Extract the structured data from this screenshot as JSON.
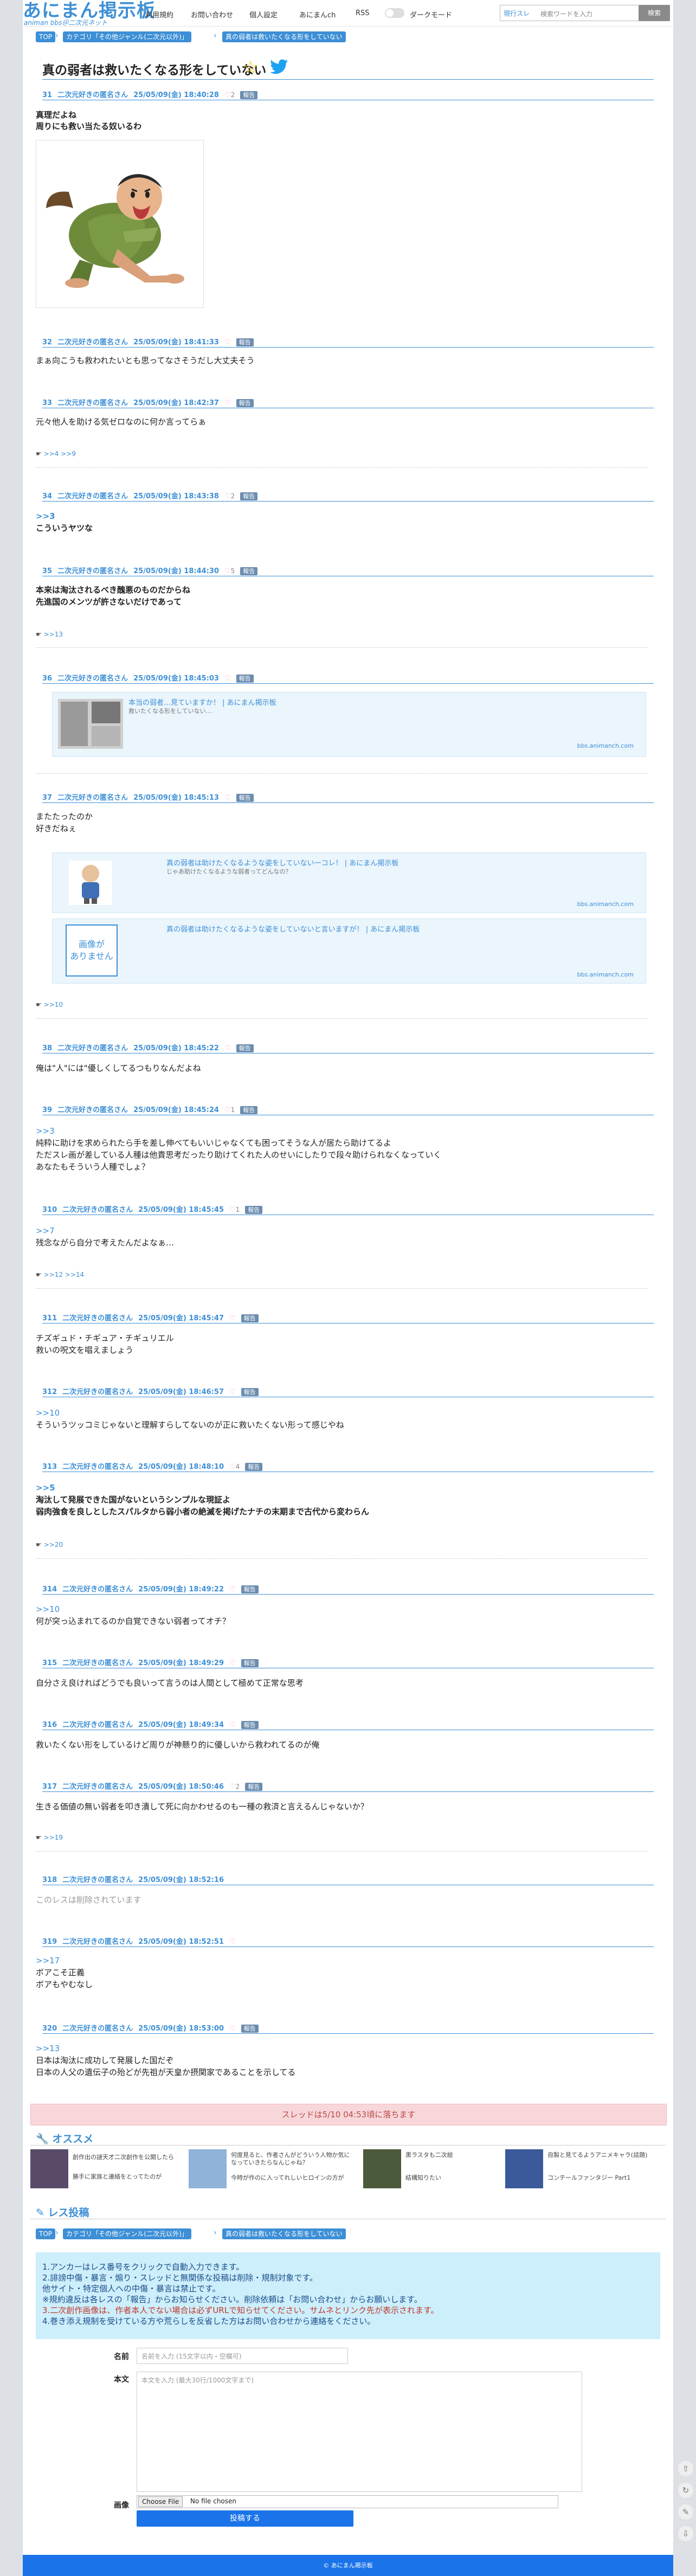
{
  "header": {
    "logo": "あにまん掲示板",
    "logo_sub": "animan bbs＠二次元ネット",
    "nav": [
      "利用規約",
      "お問い合わせ",
      "個人設定",
      "あにまんch",
      "RSS",
      "ダークモード"
    ],
    "search_scope": "現行スレ",
    "search_placeholder": "検索ワードを入力",
    "search_button": "検索"
  },
  "breadcrumb": [
    "TOP",
    "カテゴリ「その他ジャンル(二次元以外)」",
    "真の弱者は救いたくなる形をしていない"
  ],
  "thread_title": "真の弱者は救いたくなる形をしていない",
  "posts": [
    {
      "num": "31",
      "name": "二次元好きの匿名さん",
      "date": "25/05/09(金) 18:40:28",
      "likes": "2",
      "lines": [
        "真理だよね",
        "周りにも救い当たる奴いるわ"
      ],
      "bold": true,
      "replies": ""
    },
    {
      "num": "32",
      "name": "二次元好きの匿名さん",
      "date": "25/05/09(金) 18:41:33",
      "likes": "",
      "lines": [
        "まぁ向こうも救われたいとも思ってなさそうだし大丈夫そう"
      ],
      "bold": false,
      "replies": ""
    },
    {
      "num": "33",
      "name": "二次元好きの匿名さん",
      "date": "25/05/09(金) 18:42:37",
      "likes": "",
      "lines": [
        "元々他人を助ける気ゼロなのに何か言ってらぁ"
      ],
      "bold": false,
      "replies": ">>4 >>9"
    },
    {
      "num": "34",
      "name": "二次元好きの匿名さん",
      "date": "25/05/09(金) 18:43:38",
      "likes": "2",
      "lines": [
        ">>3",
        "こういうヤツな"
      ],
      "bold": true,
      "replies": ""
    },
    {
      "num": "35",
      "name": "二次元好きの匿名さん",
      "date": "25/05/09(金) 18:44:30",
      "likes": "5",
      "lines": [
        "本来は淘汰されるべき醜悪のものだからね",
        "先進国のメンツが許さないだけであって"
      ],
      "bold": true,
      "replies": ">>13"
    },
    {
      "num": "36",
      "name": "二次元好きの匿名さん",
      "date": "25/05/09(金) 18:45:03",
      "likes": "",
      "lines": [],
      "bold": false,
      "replies": ""
    },
    {
      "num": "37",
      "name": "二次元好きの匿名さん",
      "date": "25/05/09(金) 18:45:13",
      "likes": "",
      "lines": [
        "またたったのか",
        "好きだねぇ"
      ],
      "bold": false,
      "replies": ">>10"
    },
    {
      "num": "38",
      "name": "二次元好きの匿名さん",
      "date": "25/05/09(金) 18:45:22",
      "likes": "",
      "lines": [
        "俺は\"人\"には\"優しくしてるつもりなんだよね"
      ],
      "bold": false,
      "replies": ""
    },
    {
      "num": "39",
      "name": "二次元好きの匿名さん",
      "date": "25/05/09(金) 18:45:24",
      "likes": "1",
      "lines": [
        ">>3",
        "純粋に助けを求められたら手を差し伸べてもいいじゃなくても困ってそうな人が居たら助けてるよ",
        "ただスレ画が差している人種は他責思考だったり助けてくれた人のせいにしたりで段々助けられなくなっていく",
        "あなたもそういう人種でしょ？"
      ],
      "bold": false,
      "replies": ""
    },
    {
      "num": "310",
      "name": "二次元好きの匿名さん",
      "date": "25/05/09(金) 18:45:45",
      "likes": "1",
      "lines": [
        ">>7",
        "残念ながら自分で考えたんだよなぁ…"
      ],
      "bold": false,
      "replies": ">>12 >>14"
    },
    {
      "num": "311",
      "name": "二次元好きの匿名さん",
      "date": "25/05/09(金) 18:45:47",
      "likes": "",
      "lines": [
        "チズギュド・チギュア・チギュリエル",
        "救いの呪文を唱えましょう"
      ],
      "bold": false,
      "replies": ""
    },
    {
      "num": "312",
      "name": "二次元好きの匿名さん",
      "date": "25/05/09(金) 18:46:57",
      "likes": "",
      "lines": [
        ">>10",
        "そういうツッコミじゃないと理解すらしてないのが正に救いたくない形って感じやね"
      ],
      "bold": false,
      "replies": ""
    },
    {
      "num": "313",
      "name": "二次元好きの匿名さん",
      "date": "25/05/09(金) 18:48:10",
      "likes": "4",
      "lines": [
        ">>5",
        "淘汰して発展できた国がないというシンプルな現証よ",
        "弱肉強食を良しとしたスパルタから弱小者の絶滅を掲げたナチの末期まで古代から変わらん"
      ],
      "bold": true,
      "replies": ">>20"
    },
    {
      "num": "314",
      "name": "二次元好きの匿名さん",
      "date": "25/05/09(金) 18:49:22",
      "likes": "",
      "lines": [
        ">>10",
        "何が突っ込まれてるのか自覚できない弱者ってオチ？"
      ],
      "bold": false,
      "replies": ""
    },
    {
      "num": "315",
      "name": "二次元好きの匿名さん",
      "date": "25/05/09(金) 18:49:29",
      "likes": "",
      "lines": [
        "自分さえ良ければどうでも良いって言うのは人間として極めて正常な思考"
      ],
      "bold": false,
      "replies": ""
    },
    {
      "num": "316",
      "name": "二次元好きの匿名さん",
      "date": "25/05/09(金) 18:49:34",
      "likes": "",
      "lines": [
        "救いたくない形をしているけど周りが神懸り的に優しいから救われてるのが俺"
      ],
      "bold": false,
      "replies": ""
    },
    {
      "num": "317",
      "name": "二次元好きの匿名さん",
      "date": "25/05/09(金) 18:50:46",
      "likes": "2",
      "lines": [
        "生きる価値の無い弱者を叩き潰して死に向かわせるのも一種の救済と言えるんじゃないか？"
      ],
      "bold": false,
      "replies": ">>19"
    },
    {
      "num": "318",
      "name": "二次元好きの匿名さん",
      "date": "25/05/09(金) 18:52:16",
      "likes": "",
      "lines": [
        "このレスは削除されています"
      ],
      "bold": false,
      "deleted": true,
      "replies": ""
    },
    {
      "num": "319",
      "name": "二次元好きの匿名さん",
      "date": "25/05/09(金) 18:52:51",
      "likes": "",
      "lines": [
        ">>17",
        "ボアこそ正義",
        "ボアもやむなし"
      ],
      "bold": false,
      "replies": ""
    },
    {
      "num": "320",
      "name": "二次元好きの匿名さん",
      "date": "25/05/09(金) 18:53:00",
      "likes": "",
      "lines": [
        ">>13",
        "日本は淘汰に成功して発展した国だぞ",
        "日本の人父の遺伝子の殆どが先祖が天皇か摂関家であることを示してる"
      ],
      "bold": false,
      "replies": ""
    }
  ],
  "report_label": "報告",
  "links": {
    "post6": {
      "title": "本当の弱者…見ていますか！ | あにまん掲示板",
      "desc": "救いたくなる形をしていない…",
      "domain": "bbs.animanch.com"
    },
    "post7a": {
      "title": "真の弱者は助けたくなるような姿をしていない一コレ！ | あにまん掲示板",
      "desc": "じゃあ助けたくなるような弱者ってどんなの？",
      "domain": "bbs.animanch.com"
    },
    "post7b": {
      "title": "真の弱者は助けたくなるような姿をしていないと言いますが！ | あにまん掲示板",
      "desc": "",
      "domain": "bbs.animanch.com"
    },
    "noimage": "画像が\nありません"
  },
  "expire_notice": "スレッドは5/10 04:53頃に落ちます",
  "recommend": {
    "title": "オススメ",
    "items": [
      {
        "lines": [
          "創作出の謎天才二次創作を公開したら",
          "勝手に家族と連絡をとってたのが"
        ]
      },
      {
        "lines": [
          "何度見ると、作者さんがどういう人物か気に",
          "なっていきたらなんじゃね？",
          "今時が作のに入ってれしいヒロインの方が"
        ]
      },
      {
        "lines": [
          "黒ラスタも二次絵",
          "結構知りたい"
        ]
      },
      {
        "lines": [
          "自製と見てるようアニメキャラ(話題)",
          "コンテールファンタジー Part1"
        ]
      }
    ]
  },
  "post_form": {
    "title": "レス投稿",
    "rules": [
      "1.アンカーはレス番号をクリックで自動入力できます。",
      "2.誹謗中傷・暴言・煽り・スレッドと無関係な投稿は削除・規制対象です。",
      "  他サイト・特定個人への中傷・暴言は禁止です。",
      "※規約違反は各レスの「報告」からお知らせください。削除依頼は「お問い合わせ」からお願いします。",
      "3.二次創作画像は、作者本人でない場合は必ずURLで知らせてください。サムネとリンク先が表示されます。",
      "4.巻き添え規制を受けている方や荒らしを反省した方はお問い合わせから連絡をください。"
    ],
    "name_label": "名前",
    "name_placeholder": "名前を入力 (15文字以内・空欄可)",
    "body_label": "本文",
    "body_placeholder": "本文を入力 (最大30行/1000文字まで)",
    "image_label": "画像",
    "file_button": "Choose File",
    "file_status": "No file chosen",
    "submit": "投稿する"
  },
  "footer": "© あにまん掲示板",
  "colors": {
    "accent": "#3d8fd6",
    "submit": "#1a73e8",
    "notice": "#f8d7da",
    "rules": "#cdeefb"
  }
}
